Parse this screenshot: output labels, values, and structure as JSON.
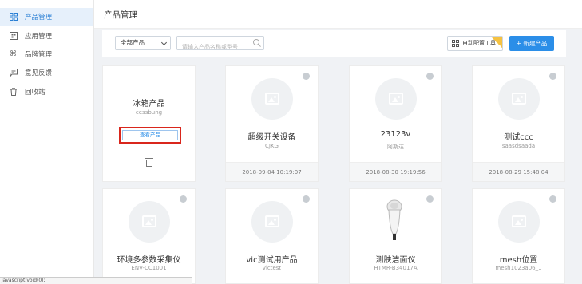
{
  "sidebar": {
    "items": [
      {
        "label": "产品管理",
        "icon": "grid-icon",
        "active": true
      },
      {
        "label": "应用管理",
        "icon": "app-icon",
        "active": false
      },
      {
        "label": "品牌管理",
        "icon": "command-icon",
        "active": false
      },
      {
        "label": "意见反馈",
        "icon": "message-icon",
        "active": false
      },
      {
        "label": "回收站",
        "icon": "trash-icon",
        "active": false
      }
    ]
  },
  "header": {
    "title": "产品管理"
  },
  "toolbar": {
    "filter_value": "全部产品",
    "search_placeholder": "请输入产品名称或型号",
    "auto_config_label": "自动配置工具",
    "new_product_label": "+ 新建产品"
  },
  "products": [
    {
      "name": "冰箱产品",
      "code": "cessbung",
      "view_label": "查看产品"
    },
    {
      "name": "超级开关设备",
      "code": "CJKG",
      "date": "2018-09-04 10:19:07"
    },
    {
      "name": "23123v",
      "code": "阿斯达",
      "date": "2018-08-30 19:19:56"
    },
    {
      "name": "测试ccc",
      "code": "saasdsaada",
      "date": "2018-08-29 15:48:04"
    },
    {
      "name": "环境多参数采集仪",
      "code": "ENV-CC1001"
    },
    {
      "name": "vic测试用产品",
      "code": "vlctest"
    },
    {
      "name": "测肤洁面仪",
      "code": "HTMR-B34017A"
    },
    {
      "name": "mesh位置",
      "code": "mesh1023a06_1"
    }
  ],
  "status_bar": "javascript:void(0);",
  "colors": {
    "accent": "#2b8ee8",
    "highlight_border": "#d9261c",
    "active_bg": "#e6f0fb"
  }
}
